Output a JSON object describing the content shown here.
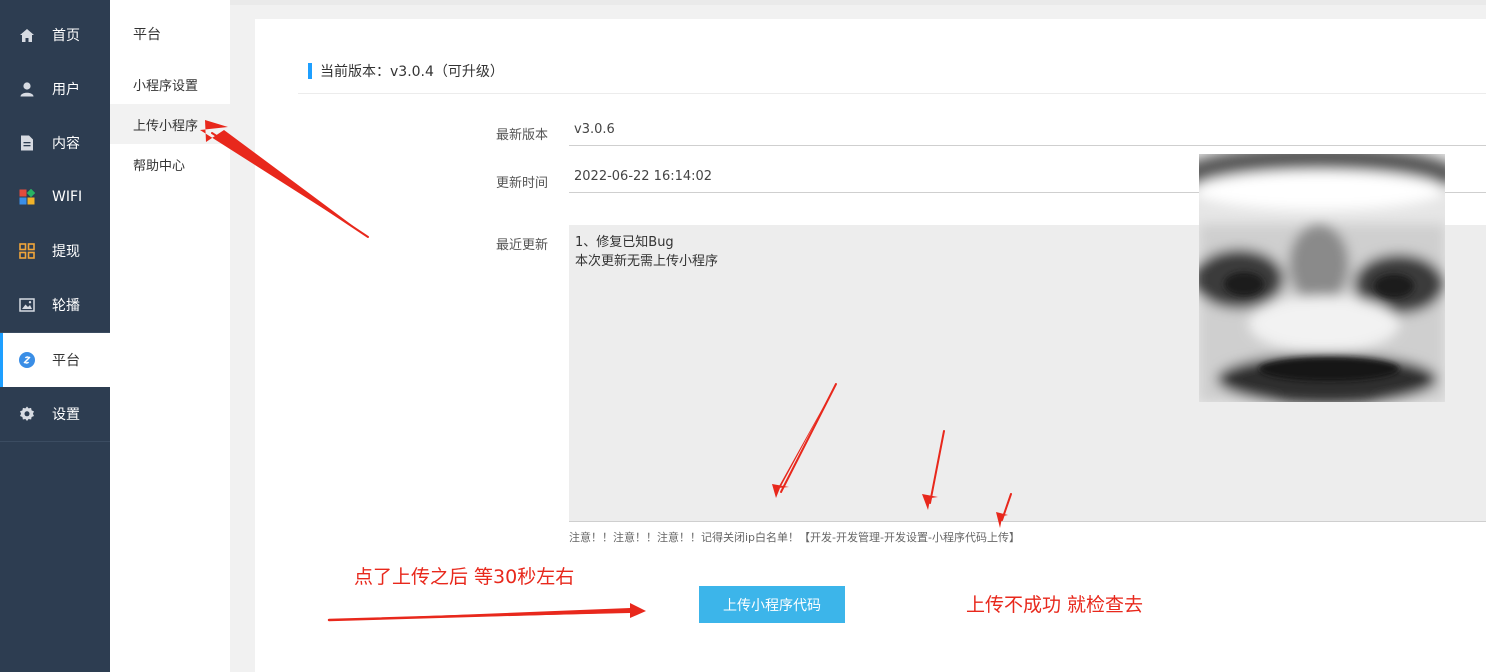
{
  "sidebar": {
    "items": [
      {
        "label": "首页",
        "icon": "home-icon"
      },
      {
        "label": "用户",
        "icon": "user-icon"
      },
      {
        "label": "内容",
        "icon": "document-icon"
      },
      {
        "label": "WIFI",
        "icon": "apps-grid-icon"
      },
      {
        "label": "提现",
        "icon": "grid-icon"
      },
      {
        "label": "轮播",
        "icon": "image-icon"
      },
      {
        "label": "平台",
        "icon": "link-icon",
        "active": true
      },
      {
        "label": "设置",
        "icon": "gear-icon"
      }
    ]
  },
  "submenu": {
    "title": "平台",
    "items": [
      "小程序设置",
      "上传小程序",
      "帮助中心"
    ],
    "active_index": 1
  },
  "main": {
    "current_version": "当前版本：v3.0.4（可升级）",
    "latest_version_label": "最新版本",
    "latest_version_value": "v3.0.6",
    "update_time_label": "更新时间",
    "update_time_value": "2022-06-22 16:14:02",
    "recent_update_label": "最近更新",
    "recent_update_lines": [
      "1、修复已知Bug",
      "本次更新无需上传小程序"
    ],
    "note": "注意！！注意！！注意！！记得关闭ip白名单！【开发-开发管理-开发设置-小程序代码上传】",
    "upload_button": "上传小程序代码"
  },
  "annotations": {
    "left_text": "点了上传之后  等30秒左右",
    "right_text": "上传不成功     就检查去",
    "color": "#e8281c"
  },
  "colors": {
    "sidebar_bg": "#2d3d51",
    "accent": "#1e9fff",
    "button": "#3cb5ea"
  }
}
